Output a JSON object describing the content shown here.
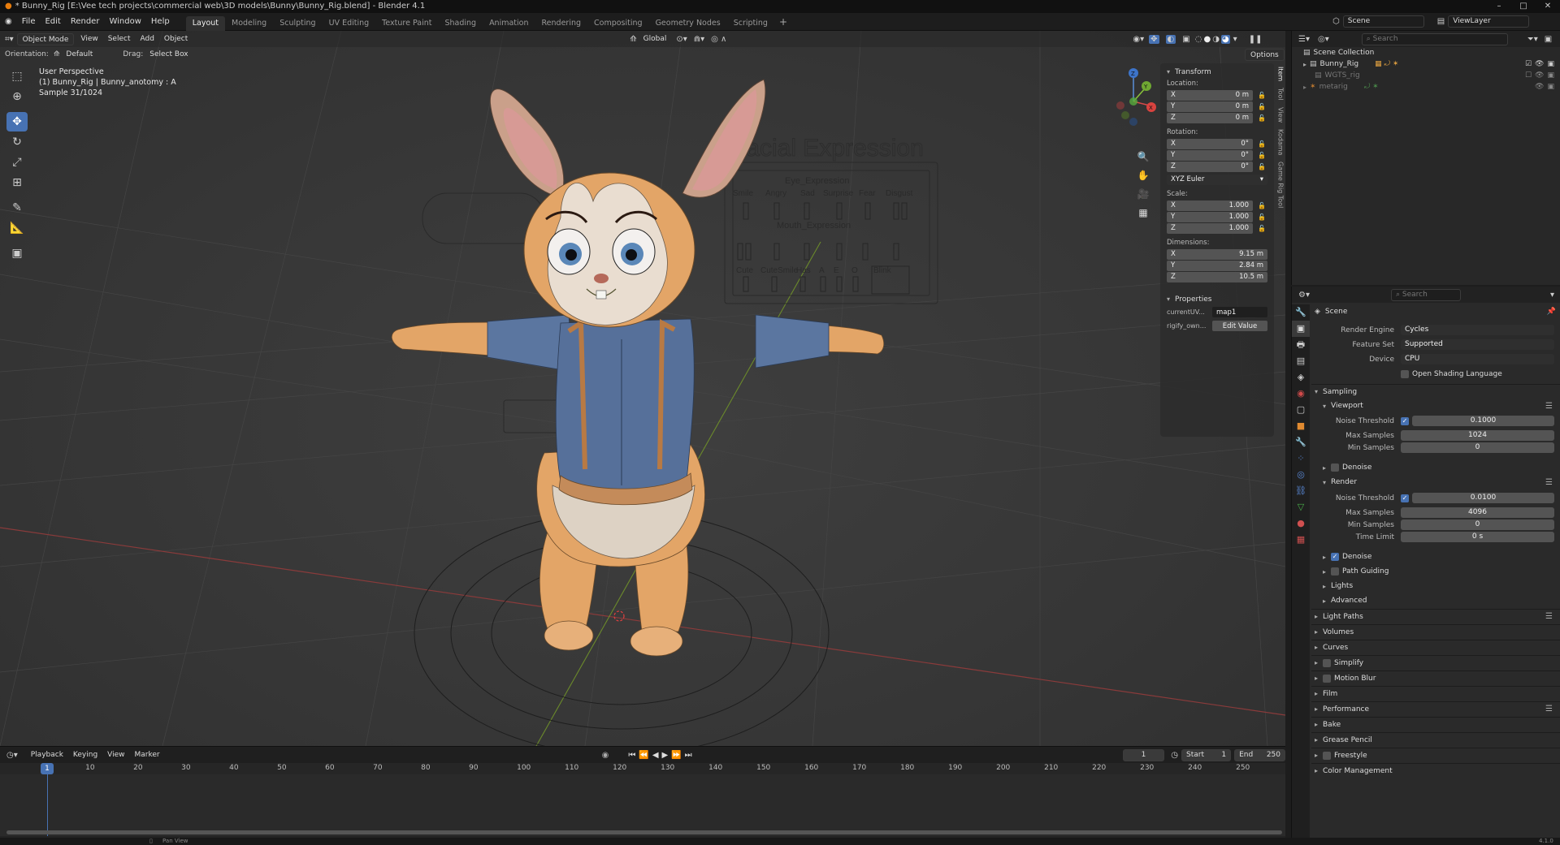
{
  "window": {
    "title": "* Bunny_Rig [E:\\Vee tech projects\\commercial web\\3D models\\Bunny\\Bunny_Rig.blend] - Blender 4.1"
  },
  "menus": [
    "File",
    "Edit",
    "Render",
    "Window",
    "Help"
  ],
  "workspaces": [
    "Layout",
    "Modeling",
    "Sculpting",
    "UV Editing",
    "Texture Paint",
    "Shading",
    "Animation",
    "Rendering",
    "Compositing",
    "Geometry Nodes",
    "Scripting"
  ],
  "scene": {
    "label": "Scene",
    "viewlayer": "ViewLayer"
  },
  "viewport": {
    "mode": "Object Mode",
    "menus": [
      "View",
      "Select",
      "Add",
      "Object"
    ],
    "transform_orientation": "Global",
    "tool_settings": {
      "orientation_label": "Orientation:",
      "orientation_value": "Default",
      "drag_label": "Drag:",
      "drag_value": "Select Box",
      "options": "Options"
    },
    "overlay": {
      "line1": "User Perspective",
      "line2": "(1) Bunny_Rig | Bunny_anotomy : A",
      "line3": "Sample 31/1024"
    },
    "background_board": {
      "title": "Facial Expression",
      "eye": "Eye_Expression",
      "mouth": "Mouth_Expression",
      "row1": [
        "Smile",
        "Angry",
        "Sad",
        "Surprise",
        "Fear",
        "Disgust"
      ],
      "row3": [
        "Cute",
        "CuteSmile",
        "Has",
        "A",
        "E",
        "O"
      ],
      "blink": "Blink"
    },
    "gizmo": {
      "x": "X",
      "y": "Y",
      "z": "Z"
    }
  },
  "npanel": {
    "tabs": [
      "Item",
      "Tool",
      "View",
      "Kodama",
      "Game Rig Tool"
    ],
    "transform_header": "Transform",
    "location_label": "Location:",
    "location": [
      {
        "axis": "X",
        "value": "0 m"
      },
      {
        "axis": "Y",
        "value": "0 m"
      },
      {
        "axis": "Z",
        "value": "0 m"
      }
    ],
    "rotation_label": "Rotation:",
    "rotation": [
      {
        "axis": "X",
        "value": "0°"
      },
      {
        "axis": "Y",
        "value": "0°"
      },
      {
        "axis": "Z",
        "value": "0°"
      }
    ],
    "rotation_mode": "XYZ Euler",
    "scale_label": "Scale:",
    "scale": [
      {
        "axis": "X",
        "value": "1.000"
      },
      {
        "axis": "Y",
        "value": "1.000"
      },
      {
        "axis": "Z",
        "value": "1.000"
      }
    ],
    "dimensions_label": "Dimensions:",
    "dimensions": [
      {
        "axis": "X",
        "value": "9.15 m"
      },
      {
        "axis": "Y",
        "value": "2.84 m"
      },
      {
        "axis": "Z",
        "value": "10.5 m"
      }
    ],
    "properties_header": "Properties",
    "prop1": {
      "label": "currentUV...",
      "value": "map1"
    },
    "prop2": {
      "label": "rigify_own...",
      "value": "Edit Value"
    }
  },
  "timeline": {
    "menus": [
      "Playback",
      "Keying",
      "View",
      "Marker"
    ],
    "current_frame": "1",
    "start_label": "Start",
    "start": "1",
    "end_label": "End",
    "end": "250",
    "ticks": [
      "1",
      "10",
      "20",
      "30",
      "40",
      "50",
      "60",
      "70",
      "80",
      "90",
      "100",
      "110",
      "120",
      "130",
      "140",
      "150",
      "160",
      "170",
      "180",
      "190",
      "200",
      "210",
      "220",
      "230",
      "240",
      "250"
    ]
  },
  "status": {
    "pan": "Pan View",
    "version": "4.1.0"
  },
  "outliner": {
    "search_placeholder": "Search",
    "items": [
      {
        "name": "Scene Collection"
      },
      {
        "name": "Bunny_Rig"
      },
      {
        "name": "WGTS_rig"
      },
      {
        "name": "metarig"
      }
    ]
  },
  "properties": {
    "search_placeholder": "Search",
    "context": "Scene",
    "render_engine_label": "Render Engine",
    "render_engine": "Cycles",
    "feature_set_label": "Feature Set",
    "feature_set": "Supported",
    "device_label": "Device",
    "device": "CPU",
    "osl": "Open Shading Language",
    "sampling": "Sampling",
    "viewport": "Viewport",
    "noise_threshold_label": "Noise Threshold",
    "vp_noise": "0.1000",
    "max_samples_label": "Max Samples",
    "vp_max": "1024",
    "min_samples_label": "Min Samples",
    "vp_min": "0",
    "denoise": "Denoise",
    "render": "Render",
    "r_noise": "0.0100",
    "r_max": "4096",
    "r_min": "0",
    "time_limit_label": "Time Limit",
    "r_time": "0 s",
    "path_guiding": "Path Guiding",
    "lights": "Lights",
    "advanced": "Advanced",
    "sections": [
      "Light Paths",
      "Volumes",
      "Curves",
      "Simplify",
      "Motion Blur",
      "Film",
      "Performance",
      "Bake",
      "Grease Pencil",
      "Freestyle",
      "Color Management"
    ]
  }
}
